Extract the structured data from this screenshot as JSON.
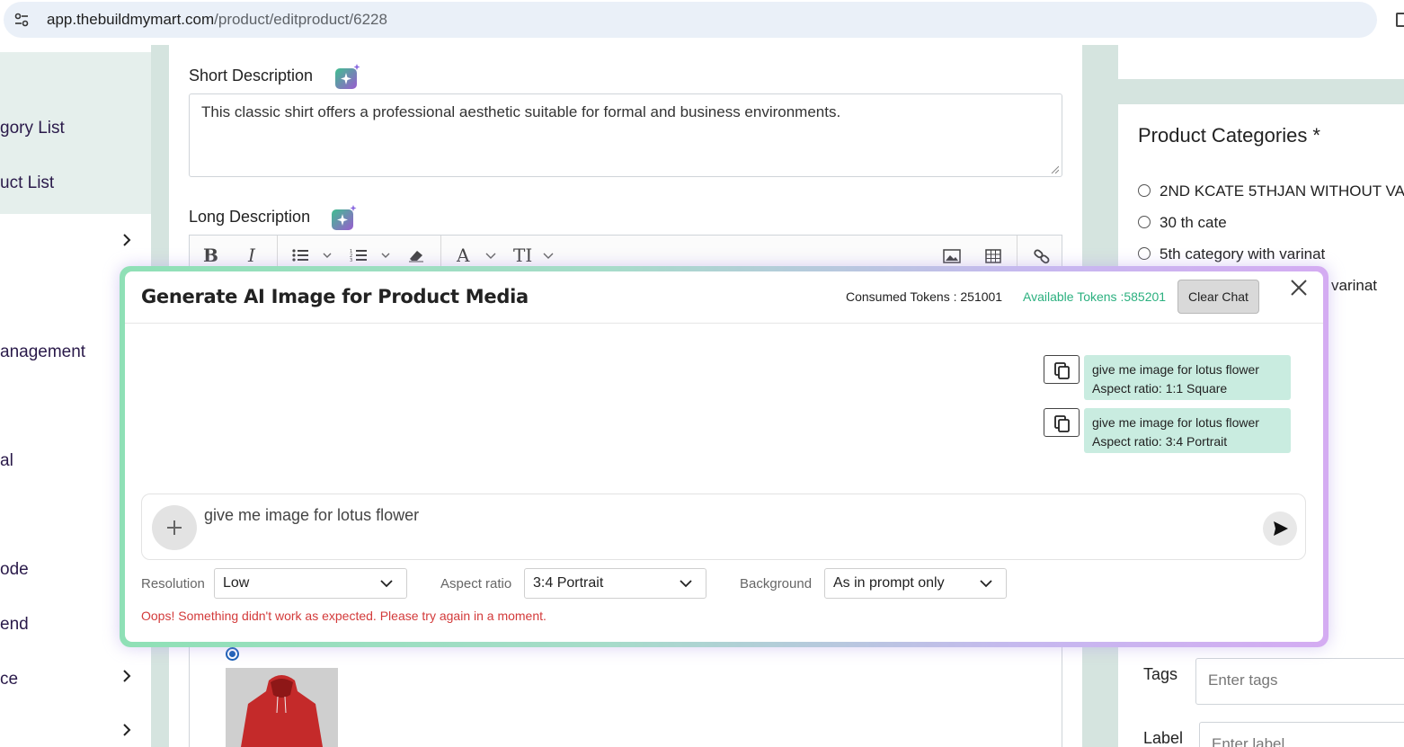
{
  "browser": {
    "url_host": "app.thebuildmymart.com",
    "url_path": "/product/editproduct/6228"
  },
  "sidebar": {
    "items": [
      {
        "label": "gory List",
        "has_chevron": false
      },
      {
        "label": "uct List",
        "has_chevron": false
      },
      {
        "label": "",
        "has_chevron": true
      },
      {
        "label": "anagement",
        "has_chevron": false
      },
      {
        "label": "al",
        "has_chevron": false
      },
      {
        "label": "ode",
        "has_chevron": false
      },
      {
        "label": "end",
        "has_chevron": false
      },
      {
        "label": "ce",
        "has_chevron": true
      },
      {
        "label": "",
        "has_chevron": true
      }
    ]
  },
  "form": {
    "short_description_label": "Short Description",
    "short_description_value": "This classic shirt offers a professional aesthetic suitable for formal and business environments.",
    "long_description_label": "Long Description"
  },
  "editor_toolbar": {
    "bold": "B",
    "italic": "I",
    "font_color": "A",
    "text_size": "TI"
  },
  "categories": {
    "title": "Product Categories *",
    "items": [
      "2ND KCATE 5THJAN WITHOUT VA",
      "30 th cate",
      "5th category with varinat"
    ],
    "partial_item": "varinat"
  },
  "right_form": {
    "tags_label": "Tags",
    "tags_placeholder": "Enter tags",
    "label_label": "Label",
    "label_placeholder": "Enter label"
  },
  "modal": {
    "title": "Generate AI Image for Product Media",
    "consumed_tokens": "Consumed Tokens : 251001",
    "available_tokens": "Available Tokens :585201",
    "clear_chat_label": "Clear Chat",
    "messages": [
      {
        "prompt": "give me image for lotus flower",
        "detail": "Aspect ratio: 1:1 Square"
      },
      {
        "prompt": "give me image for lotus flower",
        "detail": "Aspect ratio: 3:4 Portrait"
      }
    ],
    "input_value": "give me image for lotus flower",
    "resolution_label": "Resolution",
    "resolution_value": "Low",
    "aspect_label": "Aspect ratio",
    "aspect_value": "3:4 Portrait",
    "background_label": "Background",
    "background_value": "As in prompt only",
    "error": "Oops! Something didn't work as expected. Please try again in a moment."
  },
  "colors": {
    "accent_green": "#2bb07f",
    "bubble_bg": "#c9ece0",
    "error_red": "#d33a3a",
    "sidebar_bg": "#e5efec"
  }
}
